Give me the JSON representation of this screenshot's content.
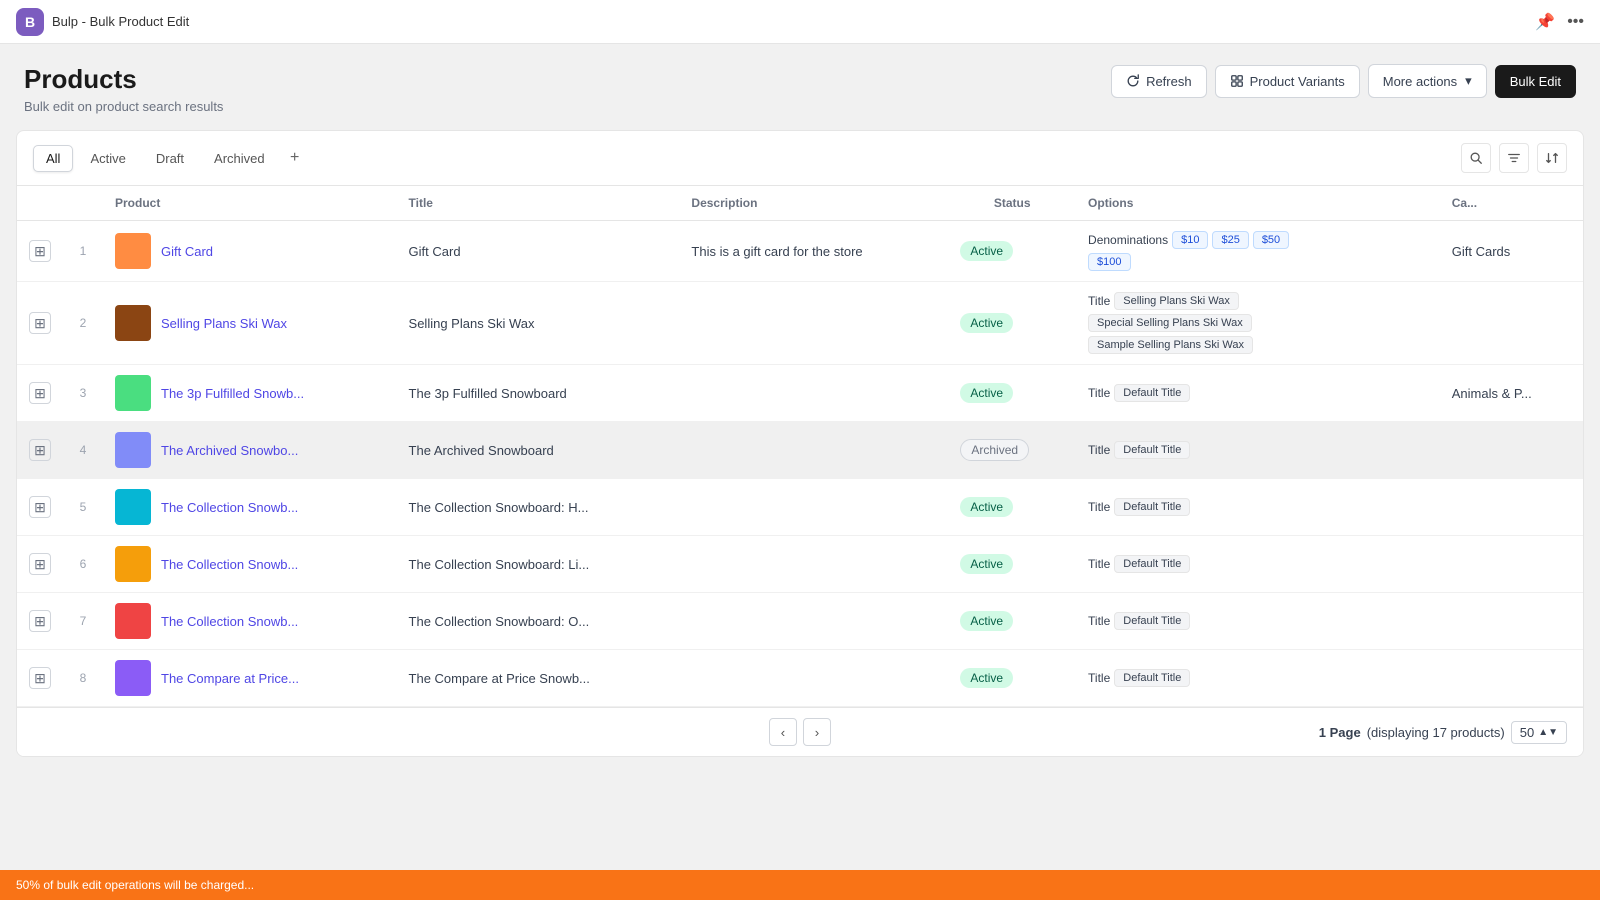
{
  "app": {
    "icon_letter": "B",
    "title": "Bulp - Bulk Product Edit"
  },
  "page": {
    "title": "Products",
    "subtitle": "Bulk edit on product search results"
  },
  "toolbar": {
    "refresh_label": "Refresh",
    "product_variants_label": "Product Variants",
    "more_actions_label": "More actions",
    "bulk_edit_label": "Bulk Edit"
  },
  "tabs": [
    {
      "id": "all",
      "label": "All",
      "active": true
    },
    {
      "id": "active",
      "label": "Active",
      "active": false
    },
    {
      "id": "draft",
      "label": "Draft",
      "active": false
    },
    {
      "id": "archived",
      "label": "Archived",
      "active": false
    }
  ],
  "table": {
    "columns": [
      "",
      "",
      "Product",
      "Title",
      "Description",
      "Status",
      "Options",
      "Ca..."
    ],
    "rows": [
      {
        "num": "1",
        "product_name": "Gift Card",
        "product_link": "Gift Card",
        "title": "Gift Card",
        "description": "This is a gift card for the store",
        "status": "Active",
        "status_type": "active",
        "options_label": "Denominations",
        "options_tags": [
          "$10",
          "$25",
          "$50",
          "$100"
        ],
        "category": "Gift Cards",
        "thumb_emoji": "🎁",
        "archived": false
      },
      {
        "num": "2",
        "product_name": "Selling Plans Ski Wax",
        "product_link": "Selling Plans Ski Wax",
        "title": "Selling Plans Ski Wax",
        "description": "",
        "status": "Active",
        "status_type": "active",
        "options_label": "Title",
        "options_tags": [
          "Selling Plans Ski Wax",
          "Special Selling Plans Ski Wax",
          "Sample Selling Plans Ski Wax"
        ],
        "category": "",
        "thumb_emoji": "🟫",
        "archived": false
      },
      {
        "num": "3",
        "product_name": "The 3p Fulfilled Snowb...",
        "product_link": "The 3p Fulfilled Snowb",
        "title": "The 3p Fulfilled Snowboard",
        "description": "",
        "status": "Active",
        "status_type": "active",
        "options_label": "Title",
        "options_tags": [
          "Default Title"
        ],
        "category": "Animals & P...",
        "thumb_emoji": "🏂",
        "archived": false
      },
      {
        "num": "4",
        "product_name": "The Archived Snowbo...",
        "product_link": "The Archived Snowbo",
        "title": "The Archived Snowboard",
        "description": "",
        "status": "Archived",
        "status_type": "archived",
        "options_label": "Title",
        "options_tags": [
          "Default Title"
        ],
        "category": "",
        "thumb_emoji": "🏂",
        "archived": true
      },
      {
        "num": "5",
        "product_name": "The Collection Snowb...",
        "product_link": "The Collection Snowb",
        "title": "The Collection Snowboard: H...",
        "description": "",
        "status": "Active",
        "status_type": "active",
        "options_label": "Title",
        "options_tags": [
          "Default Title"
        ],
        "category": "",
        "thumb_emoji": "🏂",
        "archived": false
      },
      {
        "num": "6",
        "product_name": "The Collection Snowb...",
        "product_link": "The Collection Snowb",
        "title": "The Collection Snowboard: Li...",
        "description": "",
        "status": "Active",
        "status_type": "active",
        "options_label": "Title",
        "options_tags": [
          "Default Title"
        ],
        "category": "",
        "thumb_emoji": "🏂",
        "archived": false
      },
      {
        "num": "7",
        "product_name": "The Collection Snowb...",
        "product_link": "The Collection Snowb",
        "title": "The Collection Snowboard: O...",
        "description": "",
        "status": "Active",
        "status_type": "active",
        "options_label": "Title",
        "options_tags": [
          "Default Title"
        ],
        "category": "",
        "thumb_emoji": "🏂",
        "archived": false
      },
      {
        "num": "8",
        "product_name": "The Compare at Price...",
        "product_link": "The Compare at Price",
        "title": "The Compare at Price Snowb...",
        "description": "",
        "status": "Active",
        "status_type": "active",
        "options_label": "Title",
        "options_tags": [
          "Default Title"
        ],
        "category": "",
        "thumb_emoji": "🏂",
        "archived": false
      }
    ]
  },
  "footer": {
    "page_label": "1 Page",
    "display_label": "(displaying 17 products)",
    "per_page": "50",
    "prev_disabled": true,
    "next_disabled": false
  },
  "banner": {
    "text": "50% of bulk edit operations will be charged..."
  }
}
